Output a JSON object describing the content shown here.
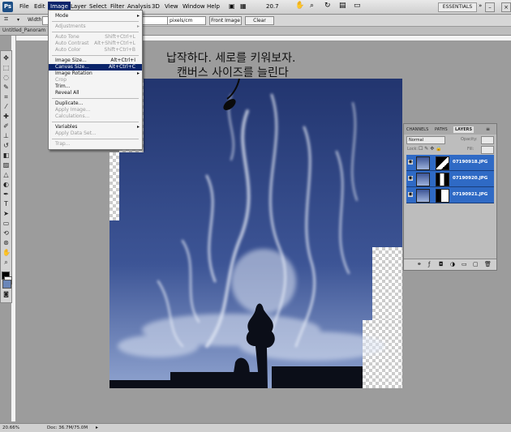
{
  "app": {
    "logo": "Ps",
    "menu": [
      "File",
      "Edit",
      "Image",
      "Layer",
      "Select",
      "Filter",
      "Analysis",
      "3D",
      "View",
      "Window",
      "Help"
    ],
    "zoom": "20.7",
    "workspace": "ESSENTIALS"
  },
  "options": {
    "width_label": "Width:",
    "units": "pixels/cm",
    "front_image": "Front Image",
    "clear": "Clear"
  },
  "document": {
    "tab": "Untitled_Panoram"
  },
  "annotation": {
    "line1": "납작하다. 세로를 키워보자.",
    "line2": "캔버스 사이즈를 늘린다"
  },
  "image_menu": {
    "items": [
      {
        "label": "Mode",
        "shortcut": "",
        "submenu": true,
        "disabled": false
      },
      {
        "label": "Adjustments",
        "shortcut": "",
        "submenu": true,
        "disabled": true
      },
      {
        "label": "Auto Tone",
        "shortcut": "Shift+Ctrl+L",
        "submenu": false,
        "disabled": true
      },
      {
        "label": "Auto Contrast",
        "shortcut": "Alt+Shift+Ctrl+L",
        "submenu": false,
        "disabled": true
      },
      {
        "label": "Auto Color",
        "shortcut": "Shift+Ctrl+B",
        "submenu": false,
        "disabled": true
      },
      {
        "label": "Image Size...",
        "shortcut": "Alt+Ctrl+I",
        "submenu": false,
        "disabled": false
      },
      {
        "label": "Canvas Size...",
        "shortcut": "Alt+Ctrl+C",
        "submenu": false,
        "disabled": false
      },
      {
        "label": "Image Rotation",
        "shortcut": "",
        "submenu": true,
        "disabled": false
      },
      {
        "label": "Crop",
        "shortcut": "",
        "submenu": false,
        "disabled": true
      },
      {
        "label": "Trim...",
        "shortcut": "",
        "submenu": false,
        "disabled": false
      },
      {
        "label": "Reveal All",
        "shortcut": "",
        "submenu": false,
        "disabled": false
      },
      {
        "label": "Duplicate...",
        "shortcut": "",
        "submenu": false,
        "disabled": false
      },
      {
        "label": "Apply Image...",
        "shortcut": "",
        "submenu": false,
        "disabled": true
      },
      {
        "label": "Calculations...",
        "shortcut": "",
        "submenu": false,
        "disabled": true
      },
      {
        "label": "Variables",
        "shortcut": "",
        "submenu": true,
        "disabled": false
      },
      {
        "label": "Apply Data Set...",
        "shortcut": "",
        "submenu": false,
        "disabled": true
      },
      {
        "label": "Trap...",
        "shortcut": "",
        "submenu": false,
        "disabled": true
      }
    ],
    "highlighted": "Canvas Size..."
  },
  "layers_panel": {
    "tabs": [
      "CHANNELS",
      "PATHS",
      "LAYERS"
    ],
    "active_tab": "LAYERS",
    "blend_mode": "Normal",
    "opacity_label": "Opacity:",
    "lock_label": "Lock:",
    "fill_label": "Fill:",
    "layers": [
      "07190918.JPG",
      "07190920.JPG",
      "07190921.JPG"
    ]
  },
  "status": {
    "zoom": "20.66%",
    "doc": "Doc: 36.7M/75.0M"
  },
  "colors": {
    "accent": "#0a246a",
    "layer_selected": "#2f6ac5",
    "sky_top": "#2a3f7e",
    "sky_bottom": "#7d92c4"
  }
}
